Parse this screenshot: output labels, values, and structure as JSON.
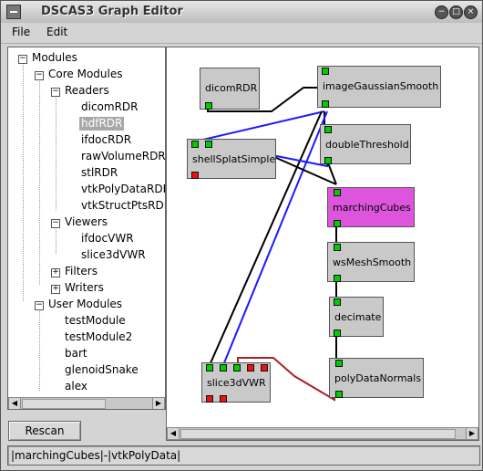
{
  "window": {
    "title": "DSCAS3 Graph Editor"
  },
  "menu": {
    "file": "File",
    "edit": "Edit"
  },
  "tree": {
    "modules": "Modules",
    "core": "Core Modules",
    "readers": "Readers",
    "reader_items": [
      "dicomRDR",
      "hdfRDR",
      "ifdocRDR",
      "rawVolumeRDR",
      "stlRDR",
      "vtkPolyDataRDR",
      "vtkStructPtsRDR"
    ],
    "viewers": "Viewers",
    "viewer_items": [
      "ifdocVWR",
      "slice3dVWR"
    ],
    "filters": "Filters",
    "writers": "Writers",
    "user": "User Modules",
    "user_items": [
      "testModule",
      "testModule2",
      "bart",
      "glenoidSnake",
      "alex"
    ],
    "selected": "hdfRDR"
  },
  "rescan_label": "Rescan",
  "nodes": {
    "dicomRDR": "dicomRDR",
    "imageGaussianSmooth": "imageGaussianSmooth",
    "shellSplatSimple": "shellSplatSimple",
    "doubleThreshold": "doubleThreshold",
    "marchingCubes": "marchingCubes",
    "wsMeshSmooth": "wsMeshSmooth",
    "decimate": "decimate",
    "slice3dVWR": "slice3dVWR",
    "polyDataNormals": "polyDataNormals"
  },
  "colors": {
    "selected_node": "#dd55dd",
    "port_green": "#00cc00",
    "port_red": "#ee1111",
    "wire_black": "#000000",
    "wire_blue": "#1a1aff",
    "wire_red": "#aa2222"
  },
  "status": "|marchingCubes|-|vtkPolyData|"
}
